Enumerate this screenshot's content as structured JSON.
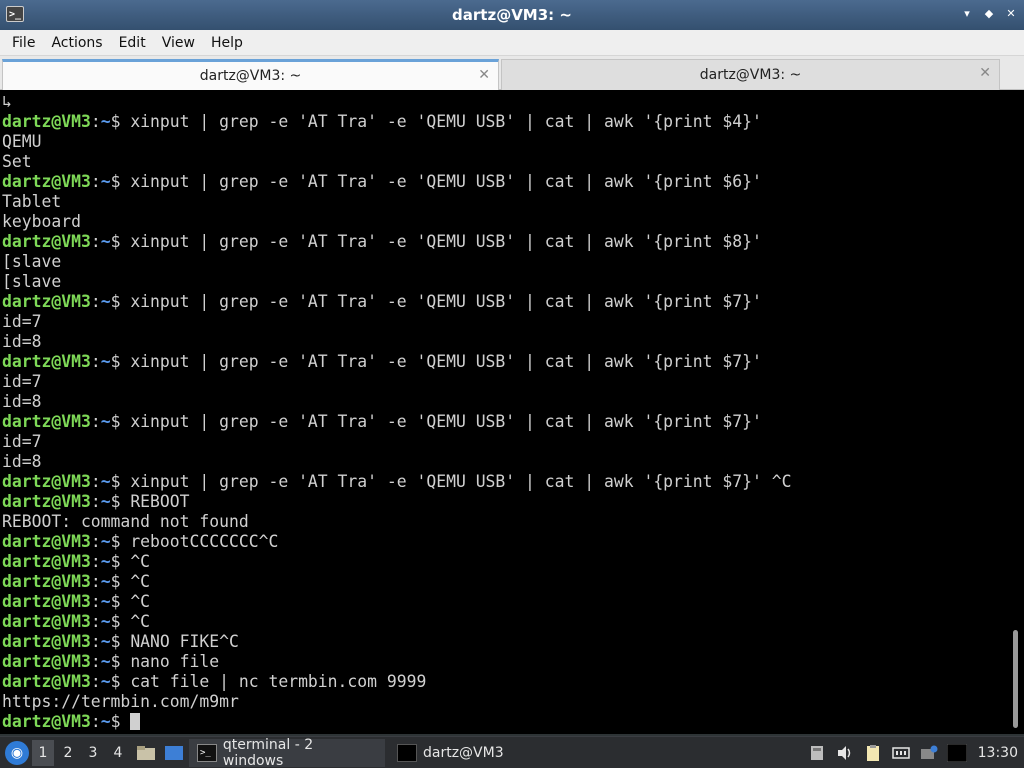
{
  "window": {
    "title": "dartz@VM3: ~",
    "controls": {
      "minimize": "▾",
      "maximize": "◆",
      "close": "✕"
    }
  },
  "menubar": [
    "File",
    "Actions",
    "Edit",
    "View",
    "Help"
  ],
  "tabs": [
    {
      "label": "dartz@VM3: ~",
      "active": true
    },
    {
      "label": "dartz@VM3: ~",
      "active": false
    }
  ],
  "terminal": {
    "prompt": {
      "user": "dartz@VM3",
      "sep": ":",
      "path": "~",
      "sigil": "$ "
    },
    "lines": [
      {
        "text": "↳"
      },
      {
        "prompt": true,
        "text": "xinput | grep -e 'AT Tra' -e 'QEMU USB' | cat | awk '{print $4}'"
      },
      {
        "text": "QEMU"
      },
      {
        "text": "Set"
      },
      {
        "prompt": true,
        "text": "xinput | grep -e 'AT Tra' -e 'QEMU USB' | cat | awk '{print $6}'"
      },
      {
        "text": "Tablet"
      },
      {
        "text": "keyboard"
      },
      {
        "prompt": true,
        "text": "xinput | grep -e 'AT Tra' -e 'QEMU USB' | cat | awk '{print $8}'"
      },
      {
        "text": "[slave"
      },
      {
        "text": "[slave"
      },
      {
        "prompt": true,
        "text": "xinput | grep -e 'AT Tra' -e 'QEMU USB' | cat | awk '{print $7}'"
      },
      {
        "text": "id=7"
      },
      {
        "text": "id=8"
      },
      {
        "prompt": true,
        "text": "xinput | grep -e 'AT Tra' -e 'QEMU USB' | cat | awk '{print $7}'"
      },
      {
        "text": "id=7"
      },
      {
        "text": "id=8"
      },
      {
        "prompt": true,
        "text": "xinput | grep -e 'AT Tra' -e 'QEMU USB' | cat | awk '{print $7}'"
      },
      {
        "text": "id=7"
      },
      {
        "text": "id=8"
      },
      {
        "prompt": true,
        "text": "xinput | grep -e 'AT Tra' -e 'QEMU USB' | cat | awk '{print $7}' ^C"
      },
      {
        "prompt": true,
        "text": "REBOOT"
      },
      {
        "text": "REBOOT: command not found"
      },
      {
        "prompt": true,
        "text": "rebootCCCCCCC^C"
      },
      {
        "prompt": true,
        "text": "^C"
      },
      {
        "prompt": true,
        "text": "^C"
      },
      {
        "prompt": true,
        "text": "^C"
      },
      {
        "prompt": true,
        "text": "^C"
      },
      {
        "prompt": true,
        "text": "NANO FIKE^C"
      },
      {
        "prompt": true,
        "text": "nano file"
      },
      {
        "prompt": true,
        "text": "cat file | nc termbin.com 9999"
      },
      {
        "text": "https://termbin.com/m9mr"
      },
      {
        "prompt": true,
        "text": "",
        "cursor": true
      }
    ]
  },
  "panel": {
    "desktops": [
      "1",
      "2",
      "3",
      "4"
    ],
    "tasks": [
      {
        "label": "qterminal - 2 windows"
      },
      {
        "label": "dartz@VM3"
      }
    ],
    "clock": "13:30"
  },
  "icons": {
    "start": "lubuntu-logo-icon",
    "file_manager": "folder-icon",
    "desktop": "show-desktop-icon",
    "tray": [
      "removable-media-icon",
      "volume-icon",
      "clipboard-icon",
      "network-icon",
      "notification-icon",
      "terminal-tray-icon"
    ]
  }
}
